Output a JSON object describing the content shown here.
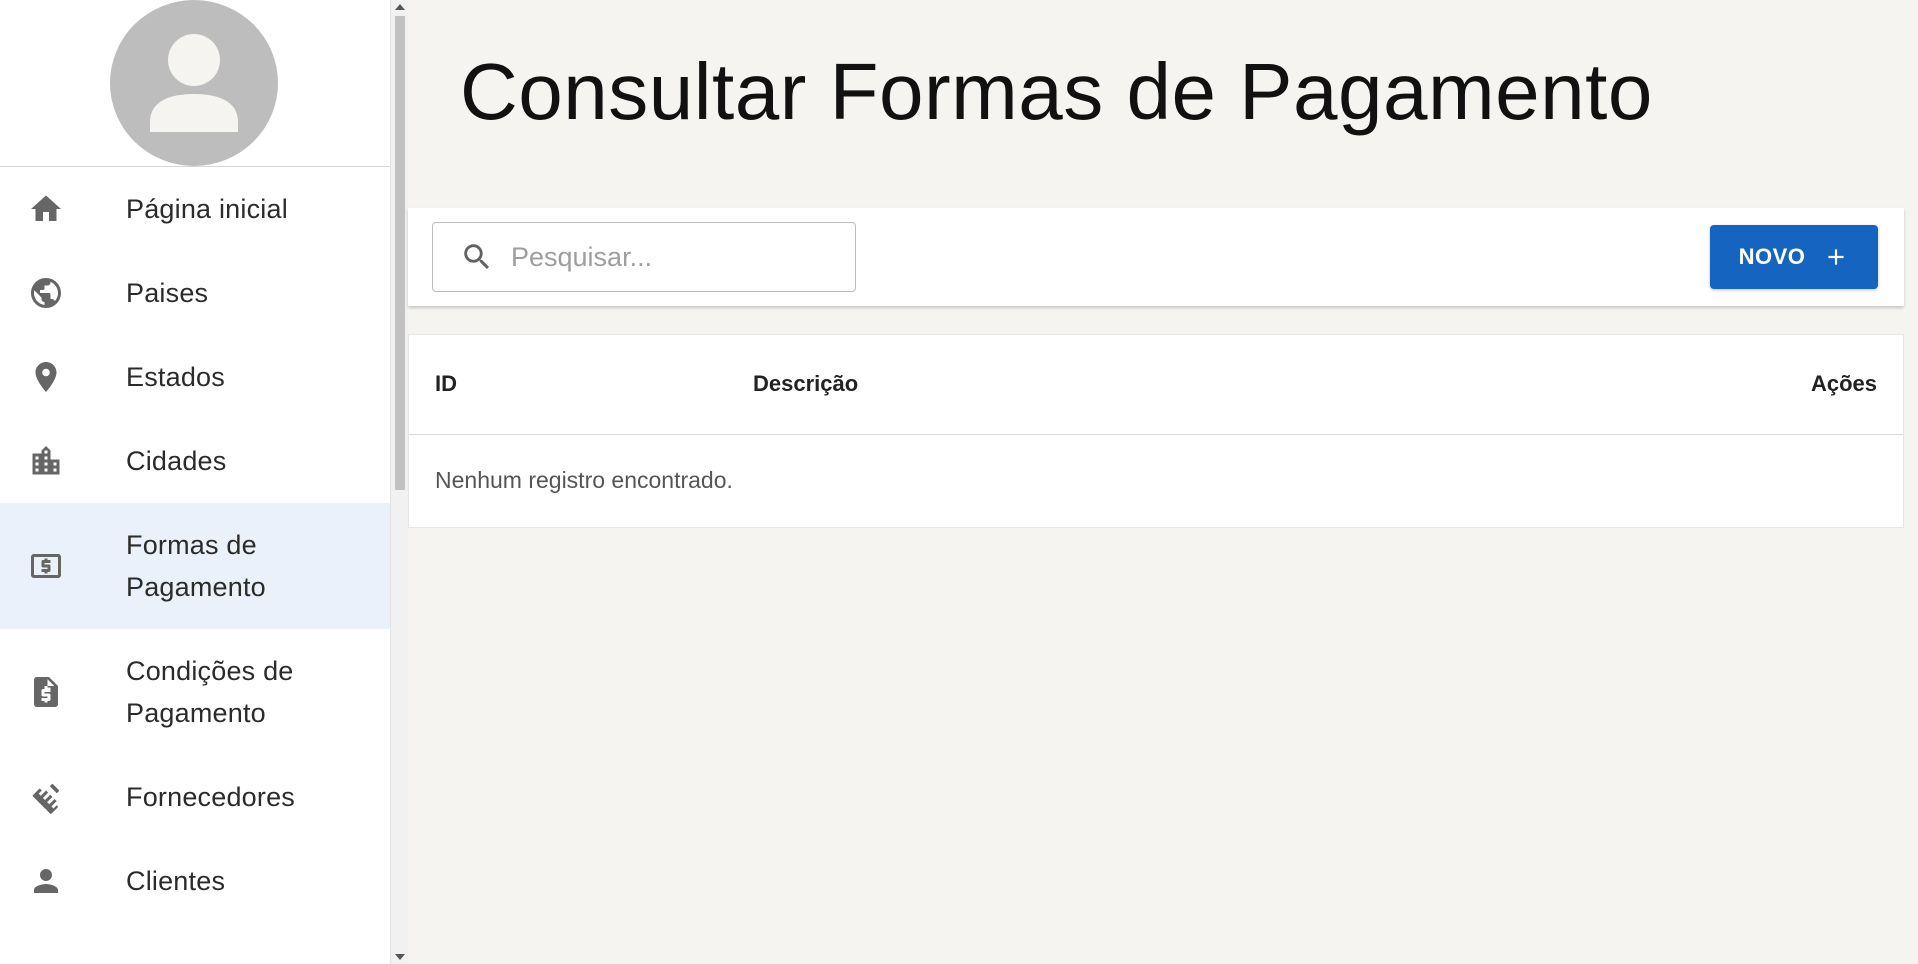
{
  "sidebar": {
    "items": [
      {
        "label": "Página inicial",
        "icon": "home-icon"
      },
      {
        "label": "Paises",
        "icon": "globe-icon"
      },
      {
        "label": "Estados",
        "icon": "location-pin-icon"
      },
      {
        "label": "Cidades",
        "icon": "city-icon"
      },
      {
        "label": "Formas de Pagamento",
        "icon": "payment-icon",
        "active": true
      },
      {
        "label": "Condições de Pagamento",
        "icon": "invoice-dollar-icon"
      },
      {
        "label": "Fornecedores",
        "icon": "handshake-icon"
      },
      {
        "label": "Clientes",
        "icon": "person-icon"
      }
    ]
  },
  "main": {
    "title": "Consultar Formas de Pagamento",
    "search": {
      "placeholder": "Pesquisar...",
      "value": ""
    },
    "new_button": {
      "label": "NOVO"
    },
    "table": {
      "columns": [
        "ID",
        "Descrição",
        "Ações"
      ],
      "rows": [],
      "empty_message": "Nenhum registro encontrado."
    }
  },
  "colors": {
    "accent": "#1565c0",
    "active_nav_bg": "#eaf1fa",
    "icon_gray": "#666666",
    "page_bg": "#f5f4f1"
  }
}
